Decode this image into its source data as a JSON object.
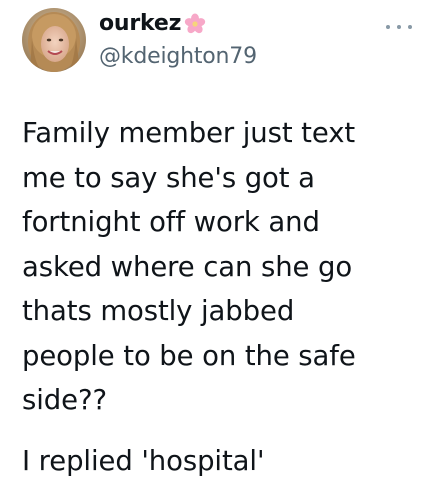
{
  "tweet": {
    "display_name": "ourkez",
    "name_emoji_icon": "cherry-blossom-icon",
    "handle": "@kdeighton79",
    "more_icon": "ellipsis-icon",
    "body_lines": [
      "Family member just text",
      "me to say she's got a",
      "fortnight off work and",
      "asked where can she go",
      "thats mostly jabbed",
      "people to be on the safe",
      "side??"
    ],
    "reply_line": "I replied 'hospital'"
  },
  "colors": {
    "text": "#0f1419",
    "handle": "#536471",
    "flower": "#f7a8c8",
    "background": "#ffffff"
  }
}
